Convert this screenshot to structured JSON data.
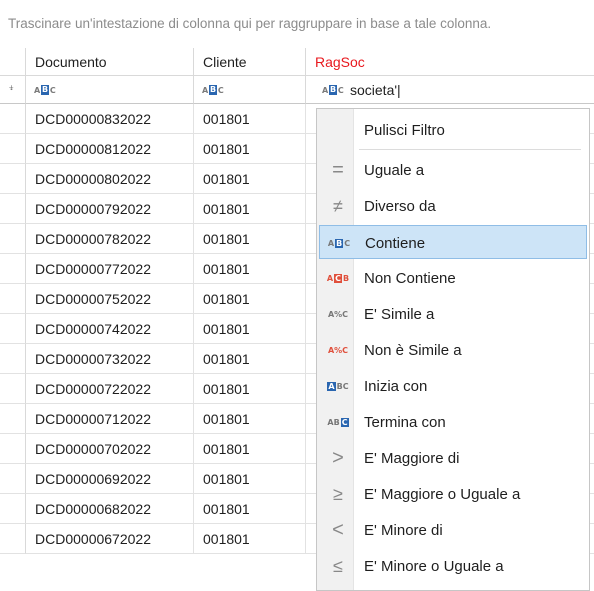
{
  "group_panel": {
    "hint": "Trascinare un'intestazione di colonna qui per raggruppare in base a tale colonna."
  },
  "columns": {
    "documento": "Documento",
    "cliente": "Cliente",
    "ragsoc": "RagSoc"
  },
  "filter_row": {
    "ragsoc_value": "societa'|"
  },
  "rows": [
    {
      "documento": "DCD00000832022",
      "cliente": "001801"
    },
    {
      "documento": "DCD00000812022",
      "cliente": "001801"
    },
    {
      "documento": "DCD00000802022",
      "cliente": "001801"
    },
    {
      "documento": "DCD00000792022",
      "cliente": "001801"
    },
    {
      "documento": "DCD00000782022",
      "cliente": "001801"
    },
    {
      "documento": "DCD00000772022",
      "cliente": "001801"
    },
    {
      "documento": "DCD00000752022",
      "cliente": "001801"
    },
    {
      "documento": "DCD00000742022",
      "cliente": "001801"
    },
    {
      "documento": "DCD00000732022",
      "cliente": "001801"
    },
    {
      "documento": "DCD00000722022",
      "cliente": "001801"
    },
    {
      "documento": "DCD00000712022",
      "cliente": "001801"
    },
    {
      "documento": "DCD00000702022",
      "cliente": "001801"
    },
    {
      "documento": "DCD00000692022",
      "cliente": "001801"
    },
    {
      "documento": "DCD00000682022",
      "cliente": "001801"
    },
    {
      "documento": "DCD00000672022",
      "cliente": "001801"
    }
  ],
  "menu": {
    "clear": "Pulisci Filtro",
    "items": [
      {
        "label": "Uguale a",
        "icon": "equals-icon"
      },
      {
        "label": "Diverso da",
        "icon": "not-equal-icon"
      },
      {
        "label": "Contiene",
        "icon": "contains-icon",
        "selected": true
      },
      {
        "label": "Non Contiene",
        "icon": "not-contains-icon"
      },
      {
        "label": "E' Simile a",
        "icon": "like-icon"
      },
      {
        "label": "Non è Simile a",
        "icon": "not-like-icon"
      },
      {
        "label": "Inizia con",
        "icon": "begins-with-icon"
      },
      {
        "label": "Termina con",
        "icon": "ends-with-icon"
      },
      {
        "label": "E' Maggiore di",
        "icon": "greater-icon"
      },
      {
        "label": "E' Maggiore o Uguale a",
        "icon": "greater-equal-icon"
      },
      {
        "label": "E' Minore di",
        "icon": "less-icon"
      },
      {
        "label": "E' Minore o Uguale a",
        "icon": "less-equal-icon"
      }
    ]
  },
  "colors": {
    "ragsoc_header": "#e8181e",
    "selection": "#cde4f7",
    "icon_blue": "#2a66b0",
    "icon_red": "#e0503c"
  }
}
